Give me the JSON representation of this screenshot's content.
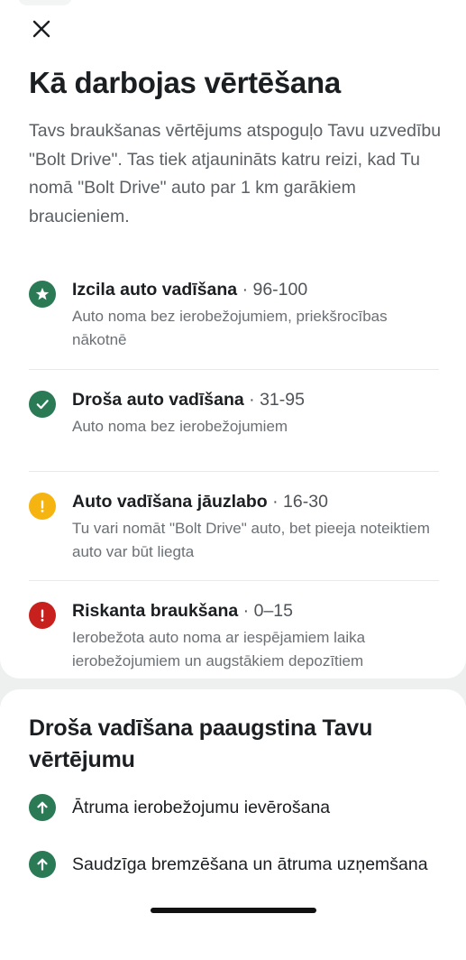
{
  "header": {
    "close_icon": "close-icon",
    "title": "Kā darbojas vērtēšana"
  },
  "intro": "Tavs braukšanas vērtējums atspoguļo Tavu uzvedību \"Bolt Drive\". Tas tiek atjaunināts katru reizi, kad Tu nomā \"Bolt Drive\" auto par 1 km garākiem braucieniem.",
  "levels": [
    {
      "name": "Izcila auto vadīšana",
      "range": " · 96-100",
      "description": "Auto noma bez ierobežojumiem, priekšrocības nākotnē",
      "icon": "star-icon",
      "color": "#2a7a55"
    },
    {
      "name": "Droša auto vadīšana",
      "range": " · 31-95",
      "description": "Auto noma bez ierobežojumiem",
      "icon": "check-icon",
      "color": "#2a7a55"
    },
    {
      "name": "Auto vadīšana jāuzlabo",
      "range": " · 16-30",
      "description": "Tu vari nomāt \"Bolt Drive\" auto, bet pieeja noteiktiem auto var būt liegta",
      "icon": "warning-icon",
      "color": "#f5b40f"
    },
    {
      "name": "Riskanta braukšana",
      "range": " · 0–15",
      "description": "Ierobežota auto noma ar iespējamiem laika ierobežojumiem un augstākiem depozītiem",
      "icon": "alert-icon",
      "color": "#c8201d"
    }
  ],
  "tips_section": {
    "title": "Droša vadīšana paaugstina Tavu vērtējumu",
    "items": [
      {
        "label": "Ātruma ierobežojumu ievērošana",
        "icon": "arrow-up-icon",
        "color": "#2a7a55"
      },
      {
        "label": "Saudzīga bremzēšana un ātruma uzņemšana",
        "icon": "arrow-up-icon",
        "color": "#2a7a55"
      }
    ]
  },
  "colors": {
    "brand_green": "#2a7a55",
    "warning_yellow": "#f5b40f",
    "danger_red": "#c8201d",
    "background": "#eef0f0"
  }
}
